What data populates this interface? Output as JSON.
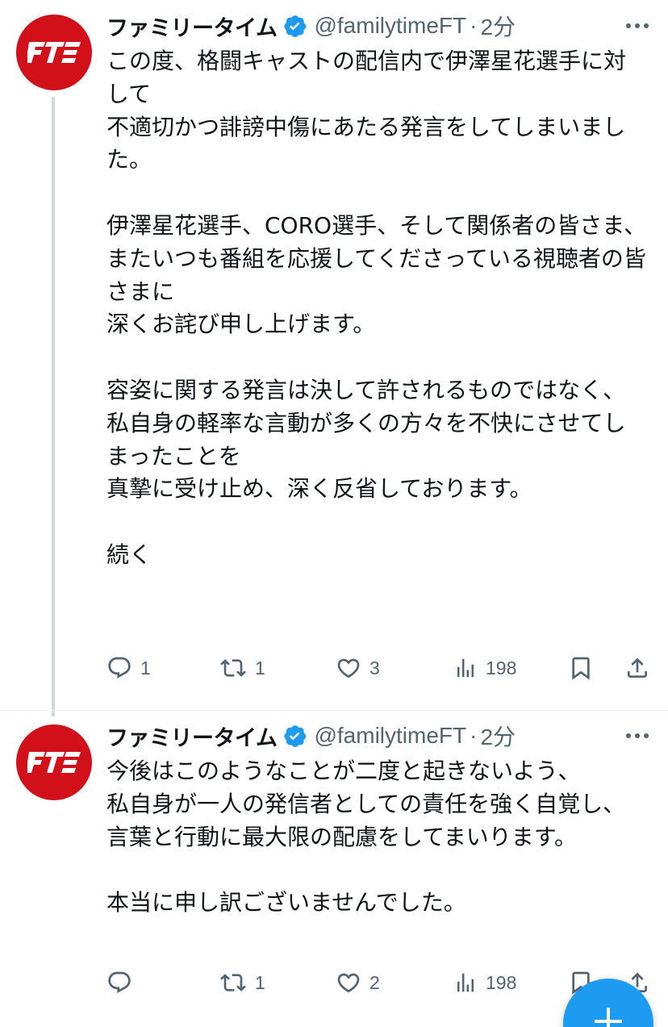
{
  "brand": {
    "avatar_color": "#d2101a",
    "avatar_logo_text": "FT",
    "verified_color": "#1d9bf0",
    "fab_color": "#1d9bf0"
  },
  "tweets": [
    {
      "display_name": "ファミリータイム",
      "handle": "@familytimeFT",
      "separator": "·",
      "time": "2分",
      "body": "この度、格闘キャストの配信内で伊澤星花選手に対して\n不適切かつ誹謗中傷にあたる発言をしてしまいました。\n\n伊澤星花選手、CORO選手、そして関係者の皆さま、\nまたいつも番組を応援してくださっている視聴者の皆さまに\n深くお詫び申し上げます。\n\n容姿に関する発言は決して許されるものではなく、\n私自身の軽率な言動が多くの方々を不快にさせてしまったことを\n真摯に受け止め、深く反省しております。\n\n続く",
      "actions": {
        "replies": "1",
        "retweets": "1",
        "likes": "3",
        "views": "198"
      }
    },
    {
      "display_name": "ファミリータイム",
      "handle": "@familytimeFT",
      "separator": "·",
      "time": "2分",
      "body": "今後はこのようなことが二度と起きないよう、\n私自身が一人の発信者としての責任を強く自覚し、\n言葉と行動に最大限の配慮をしてまいります。\n\n本当に申し訳ございませんでした。",
      "actions": {
        "replies": "",
        "retweets": "1",
        "likes": "2",
        "views": "198"
      }
    }
  ],
  "icons": {
    "more": "more-dots-icon",
    "verified": "verified-badge-icon",
    "reply": "reply-icon",
    "retweet": "retweet-icon",
    "like": "heart-icon",
    "views": "views-bar-icon",
    "bookmark": "bookmark-icon",
    "share": "share-icon",
    "compose": "compose-plus-icon"
  }
}
